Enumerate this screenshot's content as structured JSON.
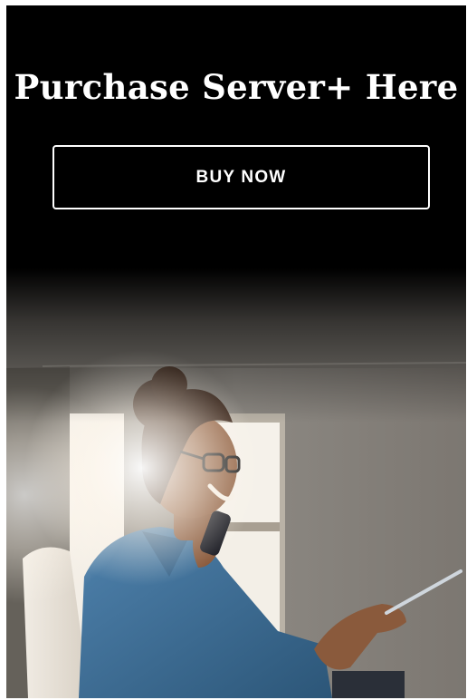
{
  "promo": {
    "headline": "Purchase Server+ Here",
    "cta_label": "BUY NOW"
  },
  "photo": {
    "subject": "woman-on-phone-holding-tablet",
    "colors": {
      "top_fade": "#000000",
      "wall": "#8b8780",
      "shirt": "#3d6e9a",
      "skin": "#8a5a3c",
      "hair": "#3a2418",
      "window_glow": "#fbf6ea"
    }
  }
}
